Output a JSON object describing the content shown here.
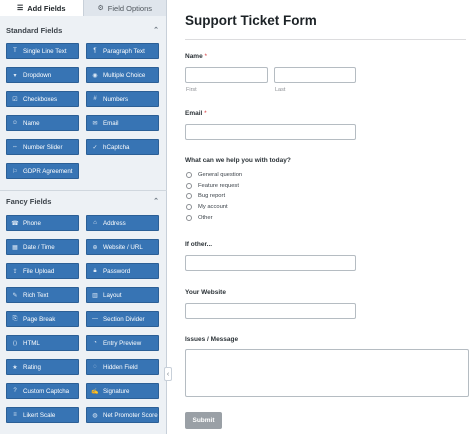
{
  "tabs": {
    "add_fields": {
      "label": "Add Fields",
      "icon": "list-icon"
    },
    "field_options": {
      "label": "Field Options",
      "icon": "sliders-icon"
    }
  },
  "standard": {
    "title": "Standard Fields",
    "fields": [
      {
        "label": "Single Line Text",
        "icon": "T"
      },
      {
        "label": "Paragraph Text",
        "icon": "¶"
      },
      {
        "label": "Dropdown",
        "icon": "▾"
      },
      {
        "label": "Multiple Choice",
        "icon": "◉"
      },
      {
        "label": "Checkboxes",
        "icon": "☑"
      },
      {
        "label": "Numbers",
        "icon": "#"
      },
      {
        "label": "Name",
        "icon": "☺"
      },
      {
        "label": "Email",
        "icon": "✉"
      },
      {
        "label": "Number Slider",
        "icon": "⇔"
      },
      {
        "label": "hCaptcha",
        "icon": "✓"
      },
      {
        "label": "GDPR Agreement",
        "icon": "⚐"
      }
    ]
  },
  "fancy": {
    "title": "Fancy Fields",
    "fields": [
      {
        "label": "Phone",
        "icon": "☎"
      },
      {
        "label": "Address",
        "icon": "⌂"
      },
      {
        "label": "Date / Time",
        "icon": "▦"
      },
      {
        "label": "Website / URL",
        "icon": "⊕"
      },
      {
        "label": "File Upload",
        "icon": "⇪"
      },
      {
        "label": "Password",
        "icon": "🔒︎"
      },
      {
        "label": "Rich Text",
        "icon": "✎"
      },
      {
        "label": "Layout",
        "icon": "▥"
      },
      {
        "label": "Page Break",
        "icon": "⎘"
      },
      {
        "label": "Section Divider",
        "icon": "—"
      },
      {
        "label": "HTML",
        "icon": "⟨⟩"
      },
      {
        "label": "Entry Preview",
        "icon": "◔"
      },
      {
        "label": "Rating",
        "icon": "★"
      },
      {
        "label": "Hidden Field",
        "icon": "◌"
      },
      {
        "label": "Custom Captcha",
        "icon": "?"
      },
      {
        "label": "Signature",
        "icon": "✍"
      },
      {
        "label": "Likert Scale",
        "icon": "≡"
      },
      {
        "label": "Net Promoter Score",
        "icon": "◍"
      }
    ]
  },
  "form": {
    "title": "Support Ticket Form",
    "name_label": "Name",
    "required_mark": "*",
    "first_sub": "First",
    "last_sub": "Last",
    "email_label": "Email",
    "help_label": "What can we help you with today?",
    "options": [
      "General question",
      "Feature request",
      "Bug report",
      "My account",
      "Other"
    ],
    "if_other_label": "If other...",
    "website_label": "Your Website",
    "issues_label": "Issues / Message",
    "submit_label": "Submit"
  },
  "colors": {
    "field_button": "#3774b4",
    "submit": "#9aa0a6",
    "required": "#d63638"
  }
}
